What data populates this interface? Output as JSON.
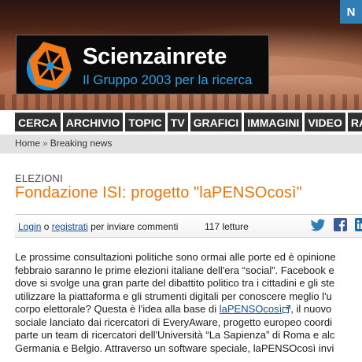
{
  "header": {
    "lang_tab": "N",
    "logo_title": "Scienzainrete",
    "logo_subtitle": "Il Gruppo 2003 per la ricerca"
  },
  "nav": {
    "items": [
      "CERCA",
      "ARCHIVIO",
      "TOPIC",
      "TV",
      "GRAFICI",
      "IMMAGINI",
      "VIDEO",
      "RAS"
    ]
  },
  "breadcrumb": {
    "home": "Home",
    "separator": "»",
    "current": "Breaking news"
  },
  "article": {
    "category": "ELEZIONI",
    "title": "Fondazione ISI: progetto \"laPENSOcosì\"",
    "meta": {
      "login": "Login",
      "or": " o ",
      "register": "registrati",
      "post_text": " per inviare commenti",
      "reads": "117 letture"
    },
    "body_lines": [
      "Le prossime consultazioni politiche sono ormai alle porte ed è opinione",
      "febbraio saranno le prime elezioni italiane dell'era “social”.  Facebook e",
      "dove si svolge una gran parte del dibattito politico tra i cittadini e gli ste",
      "utilizzare la piattaforma e gli strumenti digitali per conoscere meglio l'u",
      "corpo elettorale? Questa è l'idea alla base di "
    ],
    "link_text": "laPENSOcosì",
    "line5_tail": ", il nuovo",
    "body_lines_after": [
      "sociale lanciato dai ricercatori di EveryAware, progetto europeo coordi",
      "parte un team di ricercatori dell'Università “La Sapienza” di Roma e alc",
      "Germania e Belgio. Attraverso un software speciale, laPENSOcosì invi"
    ]
  },
  "colors": {
    "accent_orange": "#e8760a",
    "link_blue": "#1a4f9c",
    "nav_bg": "#303030",
    "lang_tab_blue": "#2f7fb6",
    "subtitle_blue": "#2fa0e0"
  },
  "icons": {
    "twitter": "twitter-icon",
    "facebook": "facebook-icon",
    "linkedin": "linkedin-icon",
    "external_link": "external-link-icon"
  }
}
